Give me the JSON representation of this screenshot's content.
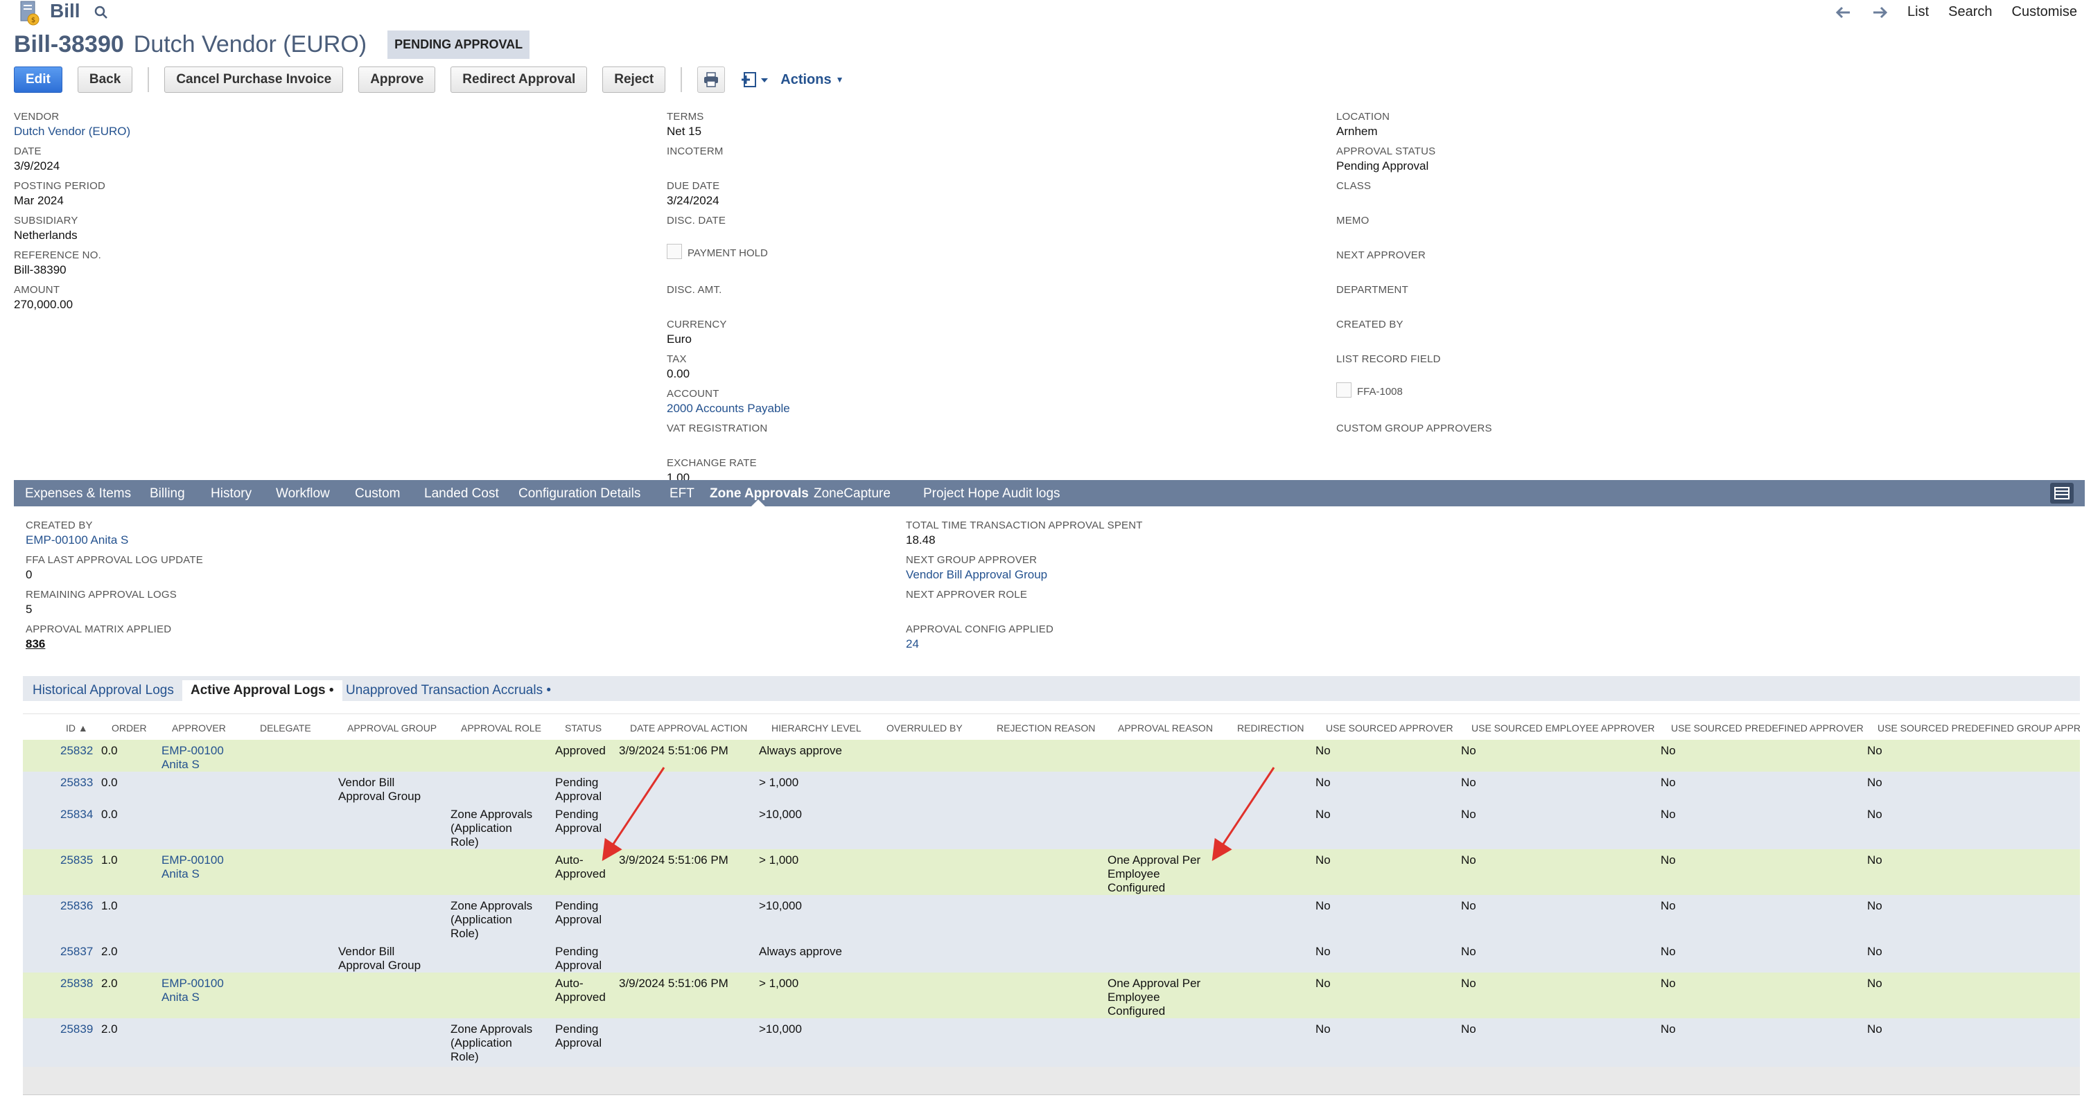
{
  "header": {
    "record_type": "Bill",
    "nav": {
      "list": "List",
      "search": "Search",
      "customise": "Customise"
    },
    "title_id": "Bill-38390",
    "title_name": "Dutch Vendor (EURO)",
    "status_badge": "PENDING APPROVAL"
  },
  "buttons": {
    "edit": "Edit",
    "back": "Back",
    "cancel_purchase_invoice": "Cancel Purchase Invoice",
    "approve": "Approve",
    "redirect_approval": "Redirect Approval",
    "reject": "Reject",
    "actions": "Actions"
  },
  "fields": {
    "col1": [
      {
        "label": "VENDOR",
        "value": "Dutch Vendor (EURO)",
        "link": true
      },
      {
        "label": "DATE",
        "value": "3/9/2024"
      },
      {
        "label": "POSTING PERIOD",
        "value": "Mar 2024"
      },
      {
        "label": "SUBSIDIARY",
        "value": "Netherlands"
      },
      {
        "label": "REFERENCE NO.",
        "value": "Bill-38390"
      },
      {
        "label": "AMOUNT",
        "value": "270,000.00"
      }
    ],
    "col2": [
      {
        "label": "TERMS",
        "value": "Net 15"
      },
      {
        "label": "INCOTERM",
        "value": ""
      },
      {
        "label": "DUE DATE",
        "value": "3/24/2024"
      },
      {
        "label": "DISC. DATE",
        "value": ""
      },
      {
        "label": "PAYMENT HOLD",
        "value": ""
      },
      {
        "label": "DISC. AMT.",
        "value": ""
      },
      {
        "label": "CURRENCY",
        "value": "Euro"
      },
      {
        "label": "TAX",
        "value": "0.00"
      },
      {
        "label": "ACCOUNT",
        "value": "2000 Accounts Payable",
        "link": true
      },
      {
        "label": "VAT REGISTRATION",
        "value": ""
      },
      {
        "label": "EXCHANGE RATE",
        "value": "1.00"
      }
    ],
    "col3": [
      {
        "label": "LOCATION",
        "value": "Arnhem"
      },
      {
        "label": "APPROVAL STATUS",
        "value": "Pending Approval"
      },
      {
        "label": "CLASS",
        "value": ""
      },
      {
        "label": "MEMO",
        "value": ""
      },
      {
        "label": "NEXT APPROVER",
        "value": ""
      },
      {
        "label": "DEPARTMENT",
        "value": ""
      },
      {
        "label": "CREATED BY",
        "value": ""
      },
      {
        "label": "LIST RECORD FIELD",
        "value": ""
      },
      {
        "label": "FFA-1008",
        "value": ""
      },
      {
        "label": "CUSTOM GROUP APPROVERS",
        "value": ""
      }
    ]
  },
  "subtabs": [
    "Expenses & Items",
    "Billing",
    "History",
    "Workflow",
    "Custom",
    "Landed Cost",
    "Configuration Details",
    "EFT",
    "Zone Approvals",
    "ZoneCapture",
    "Project Hope Audit logs"
  ],
  "zone": {
    "left": [
      {
        "label": "CREATED BY",
        "value": "EMP-00100 Anita S",
        "link": true
      },
      {
        "label": "FFA LAST APPROVAL LOG UPDATE",
        "value": "0"
      },
      {
        "label": "REMAINING APPROVAL LOGS",
        "value": "5"
      },
      {
        "label": "APPROVAL MATRIX APPLIED",
        "value": "836"
      }
    ],
    "right": [
      {
        "label": "TOTAL TIME TRANSACTION APPROVAL SPENT",
        "value": "18.48"
      },
      {
        "label": "NEXT GROUP APPROVER",
        "value": "Vendor Bill Approval Group",
        "link": true
      },
      {
        "label": "NEXT APPROVER ROLE",
        "value": ""
      },
      {
        "label": "APPROVAL CONFIG APPLIED",
        "value": "24",
        "link": true
      }
    ]
  },
  "innertabs": [
    "Historical Approval Logs",
    "Active Approval Logs •",
    "Unapproved Transaction Accruals •"
  ],
  "table": {
    "columns": [
      "ID ▲",
      "ORDER",
      "APPROVER",
      "DELEGATE",
      "APPROVAL GROUP",
      "APPROVAL ROLE",
      "STATUS",
      "DATE APPROVAL ACTION",
      "HIERARCHY LEVEL",
      "OVERRULED BY",
      "REJECTION REASON",
      "APPROVAL REASON",
      "REDIRECTION",
      "USE SOURCED APPROVER",
      "USE SOURCED EMPLOYEE APPROVER",
      "USE SOURCED PREDEFINED APPROVER",
      "USE SOURCED PREDEFINED GROUP APPROV"
    ],
    "rows": [
      {
        "id": "25832",
        "order": "0.0",
        "approver": [
          "EMP-00100",
          "Anita S"
        ],
        "group": [],
        "role": [],
        "status": [
          "Approved"
        ],
        "date": "3/9/2024 5:51:06 PM",
        "level": "Always approve",
        "reason": [],
        "u1": "No",
        "u2": "No",
        "u3": "No",
        "u4": "No"
      },
      {
        "id": "25833",
        "order": "0.0",
        "approver": [],
        "group": [
          "Vendor Bill",
          "Approval Group"
        ],
        "role": [],
        "status": [
          "Pending",
          "Approval"
        ],
        "date": "",
        "level": "> 1,000",
        "reason": [],
        "u1": "No",
        "u2": "No",
        "u3": "No",
        "u4": "No"
      },
      {
        "id": "25834",
        "order": "0.0",
        "approver": [],
        "group": [],
        "role": [
          "Zone Approvals",
          "(Application",
          "Role)"
        ],
        "status": [
          "Pending",
          "Approval"
        ],
        "date": "",
        "level": ">10,000",
        "reason": [],
        "u1": "No",
        "u2": "No",
        "u3": "No",
        "u4": "No"
      },
      {
        "id": "25835",
        "order": "1.0",
        "approver": [
          "EMP-00100",
          "Anita S"
        ],
        "group": [],
        "role": [],
        "status": [
          "Auto-",
          "Approved"
        ],
        "date": "3/9/2024 5:51:06 PM",
        "level": "> 1,000",
        "reason": [
          "One Approval Per",
          "Employee",
          "Configured"
        ],
        "u1": "No",
        "u2": "No",
        "u3": "No",
        "u4": "No"
      },
      {
        "id": "25836",
        "order": "1.0",
        "approver": [],
        "group": [],
        "role": [
          "Zone Approvals",
          "(Application",
          "Role)"
        ],
        "status": [
          "Pending",
          "Approval"
        ],
        "date": "",
        "level": ">10,000",
        "reason": [],
        "u1": "No",
        "u2": "No",
        "u3": "No",
        "u4": "No"
      },
      {
        "id": "25837",
        "order": "2.0",
        "approver": [],
        "group": [
          "Vendor Bill",
          "Approval Group"
        ],
        "role": [],
        "status": [
          "Pending",
          "Approval"
        ],
        "date": "",
        "level": "Always approve",
        "reason": [],
        "u1": "No",
        "u2": "No",
        "u3": "No",
        "u4": "No"
      },
      {
        "id": "25838",
        "order": "2.0",
        "approver": [
          "EMP-00100",
          "Anita S"
        ],
        "group": [],
        "role": [],
        "status": [
          "Auto-",
          "Approved"
        ],
        "date": "3/9/2024 5:51:06 PM",
        "level": "> 1,000",
        "reason": [
          "One Approval Per",
          "Employee",
          "Configured"
        ],
        "u1": "No",
        "u2": "No",
        "u3": "No",
        "u4": "No"
      },
      {
        "id": "25839",
        "order": "2.0",
        "approver": [],
        "group": [],
        "role": [
          "Zone Approvals",
          "(Application",
          "Role)"
        ],
        "status": [
          "Pending",
          "Approval"
        ],
        "date": "",
        "level": ">10,000",
        "reason": [],
        "u1": "No",
        "u2": "No",
        "u3": "No",
        "u4": "No"
      }
    ]
  },
  "colors": {
    "accent": "#24528f",
    "title": "#4a5d7a",
    "subtab_bar": "#6b7e9b",
    "row_green": "#e4f0cc",
    "row_blue": "#e3e8ef",
    "annotation_arrow": "#e0312b"
  }
}
